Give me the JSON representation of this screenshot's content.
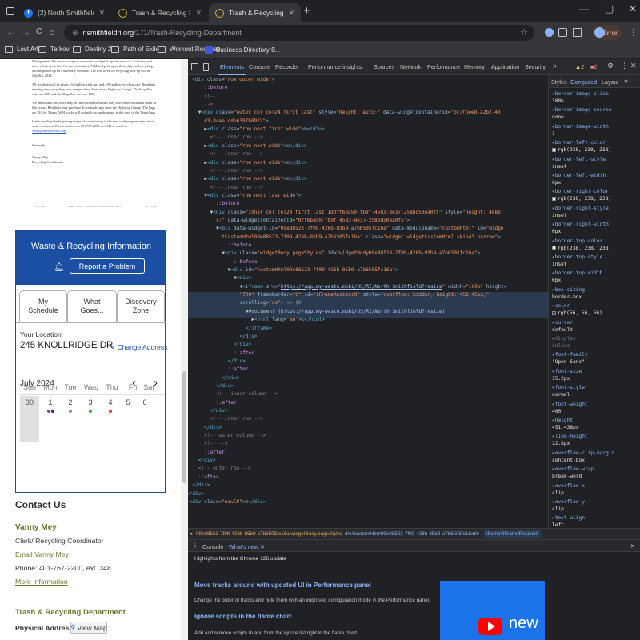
{
  "browser": {
    "tabs": [
      {
        "title": "(2) North Smithfield, Rhode Isla",
        "active": false
      },
      {
        "title": "Trash & Recycling Department |",
        "active": false
      },
      {
        "title": "Trash & Recycling Department |",
        "active": true
      }
    ],
    "new_tab": "+",
    "window_controls": {
      "min": "—",
      "max": "▢",
      "close": "✕"
    },
    "nav": {
      "back": "←",
      "forward": "→",
      "reload": "C",
      "home": "⌂"
    },
    "url_host": "nsmithfieldri.org",
    "url_path": "/171/Trash-Recycling-Department",
    "profile_error": "Error",
    "bookmarks": [
      "Lost Ark",
      "Tarkov",
      "Destiny 2",
      "Path of Exile",
      "Workout Routines",
      "Business Directory S..."
    ]
  },
  "letter": {
    "p1": "Management. We are switching to automated trash pick-ups because it is a cleaner, and more efficient method for our community. WM will pick up trash weekly, and recycling will be picked up on a biweekly schedule. The first week for recycling pick-up will be July 8th, 2024.",
    "p2": "All residents will be given a 64-gallon trash cart and a 96-gallon recycling cart. Residents needing more recycling carts can purchase them at our Highway Garage. The 64-gallon carts are $45, and the 96-gallon carts are $55.",
    "p3": "We understand that there may be times when Residents may have more trash than usual. If this occurs Residents may purchase Town trash bags from the Highway Garage. The bags are $10 for 5 bags. WM trucks will not pick up anything not in the carts or the Town bags.",
    "p4": "Understanding the beginning stages of transitioning to the new trash program may cause some confusion. Please reach us at 401 767 2200 ext. 348 or email at",
    "p4_link": "vmey@nsmithfieldri.org",
    "sincerely": "Sincerely,",
    "name": "Vanny Mey",
    "role": "Recycling Coordinator",
    "footer_l": "* 401 767 2200",
    "footer_c": "1 MAIN STREET · SLATERSVILLE, RHODE ISLAND 02876",
    "footer_r": "* 401 767 2200"
  },
  "widget": {
    "title": "Waste & Recycling Information",
    "report_button": "Report a Problem",
    "tabs": [
      {
        "label": "My Schedule",
        "l1": "My",
        "l2": "Schedule"
      },
      {
        "label": "What Goes...",
        "l1": "What",
        "l2": "Goes..."
      },
      {
        "label": "Discovery Zone",
        "l1": "Discovery",
        "l2": "Zone"
      }
    ],
    "location_label": "Your Location:",
    "address": "245 KNOLLRIDGE DR",
    "change_address": "Change Address",
    "month": "July 2024",
    "prev": "‹",
    "next": "›",
    "weekdays": [
      "Sun",
      "Mon",
      "Tue",
      "Wed",
      "Thu",
      "Fri",
      "Sat"
    ],
    "days": [
      "30",
      "1",
      "2",
      "3",
      "4",
      "5",
      "6"
    ],
    "colors": {
      "purple": "#7b3fa0",
      "navy": "#222a55",
      "gray": "#8d8d8d",
      "green": "#43a047",
      "red": "#e53935"
    }
  },
  "contact": {
    "heading": "Contact Us",
    "name": "Vanny Mey",
    "role": "Clerk/ Recycling Coordinator",
    "email": "Email Vanny Mey",
    "phone": "Phone: 401-767-2200, ext. 348",
    "more": "More Information",
    "dept": "Trash & Recycling Department",
    "address_label": "Physical Address",
    "view_map": "View Map"
  },
  "devtools": {
    "tabs": [
      "Elements",
      "Console",
      "Recorder",
      "Performance insights",
      "Sources",
      "Network",
      "Performance",
      "Memory",
      "Application",
      "Security"
    ],
    "more": "»",
    "warnings": "2",
    "errors": "2",
    "styles_tabs": [
      "Styles",
      "Computed",
      "Layout"
    ],
    "dom": [
      {
        "i": 11,
        "t": "<span class='tg'>&lt;div</span> <span class='an'>class</span>=<span class='av'>\"row outer wide\"</span><span class='tg'>&gt;</span>"
      },
      {
        "i": 13,
        "t": "<span class='ps'>::before</span>"
      },
      {
        "i": 13,
        "t": "<span class='cm'>&lt;!--</span>"
      },
      {
        "i": 13,
        "t": "<span class='cm'>--&gt;</span>"
      },
      {
        "i": 12,
        "t": "▼<span class='tg'>&lt;div</span> <span class='an'>class</span>=<span class='av'>\"outer col col24 first last\"</span> <span class='an'>style</span>=<span class='av'>\"height: auto;\"</span> <span class='an'>data-widgetcontainerid</span>=<span class='av'>\"bc7fbeed-a2b2-43</span>"
      },
      {
        "i": 13,
        "t": "<span class='av'>d3-8cee-cdb6397b8922\"</span><span class='tg'>&gt;</span>"
      },
      {
        "i": 13,
        "t": "▶<span class='tg'>&lt;div</span> <span class='an'>class</span>=<span class='av'>\"row nest first wide\"</span><span class='tg'>&gt;</span><span class='gry'>⊡</span><span class='tg'>&lt;/div&gt;</span>"
      },
      {
        "i": 14,
        "t": "<span class='cm'>&lt;!-- inner row --&gt;</span>"
      },
      {
        "i": 13,
        "t": "▶<span class='tg'>&lt;div</span> <span class='an'>class</span>=<span class='av'>\"row nest wide\"</span><span class='tg'>&gt;</span><span class='gry'>⊡</span><span class='tg'>&lt;/div&gt;</span>"
      },
      {
        "i": 14,
        "t": "<span class='cm'>&lt;!-- inner row --&gt;</span>"
      },
      {
        "i": 13,
        "t": "▶<span class='tg'>&lt;div</span> <span class='an'>class</span>=<span class='av'>\"row nest wide\"</span><span class='tg'>&gt;</span><span class='gry'>⊡</span><span class='tg'>&lt;/div&gt;</span>"
      },
      {
        "i": 14,
        "t": "<span class='cm'>&lt;!-- inner row --&gt;</span>"
      },
      {
        "i": 13,
        "t": "▶<span class='tg'>&lt;div</span> <span class='an'>class</span>=<span class='av'>\"row nest wide\"</span><span class='tg'>&gt;</span><span class='gry'>⊡</span><span class='tg'>&lt;/div&gt;</span>"
      },
      {
        "i": 14,
        "t": "<span class='cm'>&lt;!-- inner row --&gt;</span>"
      },
      {
        "i": 13,
        "t": "▼<span class='tg'>&lt;div</span> <span class='an'>class</span>=<span class='av'>\"row nest last wide\"</span><span class='tg'>&gt;</span>"
      },
      {
        "i": 15,
        "t": "<span class='ps'>::before</span>"
      },
      {
        "i": 14,
        "t": "▼<span class='tg'>&lt;div</span> <span class='an'>class</span>=<span class='av'>\"inner col col24 first last 1d0ff6ba50-fb9f-4583-8e37-258bd50ea0f5\"</span> <span class='an'>style</span>=<span class='av'>\"height: 488p</span>"
      },
      {
        "i": 15,
        "t": "<span class='av'>x;\"</span> <span class='an'>data-widgetcontainerid</span>=<span class='av'>\"0ff6ba50-fb9f-4583-8e37-258bd50ea0f5\"</span><span class='tg'>&gt;</span>"
      },
      {
        "i": 15,
        "t": "▼<span class='tg'>&lt;div</span> <span class='an'>data-widget-id</span>=<span class='av'>\"09e88523-7f09-426b-85b9-a7b6505fc16a\"</span> <span class='an'>data-modulename</span>=<span class='av'>\"customHtml\"</span> <span class='an'>id</span>=<span class='av'>\"widge</span>"
      },
      {
        "i": 16,
        "t": "<span class='av'>tCustomHtml09e88523-7f09-426b-85b9-a7b6505fc16a\"</span> <span class='an'>class</span>=<span class='av'>\"widget widgetCustomHtml skin43 narrow\"</span><span class='tg'>&gt;</span>"
      },
      {
        "i": 17,
        "t": "<span class='ps'>::before</span>"
      },
      {
        "i": 16,
        "t": "▼<span class='tg'>&lt;div</span> <span class='an'>class</span>=<span class='av'>\"widgetBody pageStyles\"</span> <span class='an'>id</span>=<span class='av'>\"widgetBody09e88523-7f09-426b-85b9-a7b6505fc16a\"</span><span class='tg'>&gt;</span>"
      },
      {
        "i": 18,
        "t": "<span class='ps'>::before</span>"
      },
      {
        "i": 17,
        "t": "▼<span class='tg'>&lt;div</span> <span class='an'>id</span>=<span class='av'>\"customHtml09e88523-7f09-426b-85b9-a7b6505fc16a\"</span><span class='tg'>&gt;</span>"
      },
      {
        "i": 18,
        "t": "▼<span class='tg'>&lt;div&gt;</span>"
      },
      {
        "i": 19,
        "t": "▼<span class='tg'>&lt;iframe</span> <span class='an'>src</span>=<span class='av'>\"</span><span class='lk'>https://app.my-waste.mobi/US/RI/North_Smithfield?resize</span><span class='av'>\"</span> <span class='an'>width</span>=<span class='av'>\"100%\"</span> <span class='an'>height</span>="
      },
      {
        "i": 19,
        "t": "<span class='av'>\"700\"</span> <span class='an'>frameborder</span>=<span class='av'>\"0\"</span> <span class='an'>id</span>=<span class='av'>\"iFrameResizer0\"</span> <span class='an'>style</span>=<span class='av'>\"overflow: hidden; height: 451.45px;\"</span>"
      },
      {
        "i": 19,
        "t": "<span class='an'>scrolling</span>=<span class='av'>\"no\"</span><span class='tg'>&gt;</span> <span class='gry'>== $0</span>"
      },
      {
        "i": 20,
        "t": "▼#document (<span class='lk'>https://app.my-waste.mobi/US/RI/North_Smithfield?resize</span>)"
      },
      {
        "i": 21,
        "t": "▶<span class='tg'>&lt;html</span> <span class='an'>lang</span>=<span class='av'>\"en\"</span><span class='tg'>&gt;</span><span class='gry'>⊡</span><span class='tg'>&lt;/html&gt;</span>"
      },
      {
        "i": 20,
        "t": "<span class='tg'>&lt;/iframe&gt;</span>"
      },
      {
        "i": 19,
        "t": "<span class='tg'>&lt;/div&gt;</span>"
      },
      {
        "i": 18,
        "t": "<span class='tg'>&lt;/div&gt;</span>"
      },
      {
        "i": 18,
        "t": "<span class='ps'>::after</span>"
      },
      {
        "i": 17,
        "t": "<span class='tg'>&lt;/div&gt;</span>"
      },
      {
        "i": 17,
        "t": "<span class='ps'>::after</span>"
      },
      {
        "i": 16,
        "t": "<span class='tg'>&lt;/div&gt;</span>"
      },
      {
        "i": 15,
        "t": "<span class='tg'>&lt;/div&gt;</span>"
      },
      {
        "i": 15,
        "t": "<span class='cm'>&lt;!-- inner column --&gt;</span>"
      },
      {
        "i": 15,
        "t": "<span class='ps'>::after</span>"
      },
      {
        "i": 14,
        "t": "<span class='tg'>&lt;/div&gt;</span>"
      },
      {
        "i": 14,
        "t": "<span class='cm'>&lt;!-- inner row --&gt;</span>"
      },
      {
        "i": 13,
        "t": "<span class='tg'>&lt;/div&gt;</span>"
      },
      {
        "i": 13,
        "t": "<span class='cm'>&lt;!-- outer column --&gt;</span>"
      },
      {
        "i": 13,
        "t": "<span class='cm'>&lt;!--       --&gt;</span>"
      },
      {
        "i": 13,
        "t": "<span class='ps'>::after</span>"
      },
      {
        "i": 12,
        "t": "<span class='tg'>&lt;/div&gt;</span>"
      },
      {
        "i": 12,
        "t": "<span class='cm'>&lt;!-- outer row --&gt;</span>"
      },
      {
        "i": 12,
        "t": "<span class='ps'>::after</span>"
      },
      {
        "i": 11,
        "t": "<span class='tg'>&lt;/div&gt;</span>"
      },
      {
        "i": 10,
        "t": "<span class='tg'>&lt;/div&gt;</span>"
      },
      {
        "i": 10,
        "t": "▶<span class='tg'>&lt;div</span> <span class='an'>class</span>=<span class='av'>\"newCP\"</span><span class='tg'>&gt;</span><span class='gry'>⊡</span><span class='tg'>&lt;/div&gt;</span>"
      }
    ],
    "computed": [
      {
        "p": "border-image-slice",
        "v": "100%"
      },
      {
        "p": "border-image-source",
        "v": "none"
      },
      {
        "p": "border-image-width",
        "v": "1"
      },
      {
        "p": "border-left-color",
        "v": "rgb(238, 238, 238)",
        "sw": "#eeeeee"
      },
      {
        "p": "border-left-style",
        "v": "inset"
      },
      {
        "p": "border-left-width",
        "v": "0px"
      },
      {
        "p": "border-right-color",
        "v": "rgb(238, 238, 238)",
        "sw": "#eeeeee"
      },
      {
        "p": "border-right-style",
        "v": "inset"
      },
      {
        "p": "border-right-width",
        "v": "0px"
      },
      {
        "p": "border-top-color",
        "v": "rgb(238, 238, 238)",
        "sw": "#eeeeee"
      },
      {
        "p": "border-top-style",
        "v": "inset"
      },
      {
        "p": "border-top-width",
        "v": "0px"
      },
      {
        "p": "box-sizing",
        "v": "border-box"
      },
      {
        "p": "color",
        "v": "rgb(56, 56, 56)",
        "sw": "#383838"
      },
      {
        "p": "cursor",
        "v": "default"
      },
      {
        "p": "display",
        "v": "inline",
        "dim": true
      },
      {
        "p": "font-family",
        "v": "\"Open Sans\""
      },
      {
        "p": "font-size",
        "v": "15.2px"
      },
      {
        "p": "font-style",
        "v": "normal"
      },
      {
        "p": "font-weight",
        "v": "400"
      },
      {
        "p": "height",
        "v": "451.438px"
      },
      {
        "p": "line-height",
        "v": "22.8px"
      },
      {
        "p": "overflow-clip-margin",
        "v": "content-box"
      },
      {
        "p": "overflow-wrap",
        "v": "break-word"
      },
      {
        "p": "overflow-x",
        "v": "clip"
      },
      {
        "p": "overflow-y",
        "v": "clip"
      },
      {
        "p": "text-align",
        "v": "left"
      }
    ],
    "breadcrumbs": [
      "09e88523-7f09-426b-85b9-a7b6505fc16a.widgetBody.pageStyles",
      "div#customHtml09e88523-7f09-426b-85b9-a7b6505fc16a",
      "div",
      "iframe#iFrameResizer0"
    ],
    "drawer_tabs": [
      "Console",
      "What's new"
    ],
    "drawer_hint": "Highlights from the Chrome 126 update",
    "news": [
      {
        "title": "Move tracks around with updated UI in Performance panel",
        "desc": "Change the order of tracks and hide them with an improved configuration mode in the Performance panel."
      },
      {
        "title": "Ignore scripts in the flame chart",
        "desc": "Add and remove scripts to and from the ignore list right in the flame chart."
      }
    ],
    "video_label": "new"
  }
}
